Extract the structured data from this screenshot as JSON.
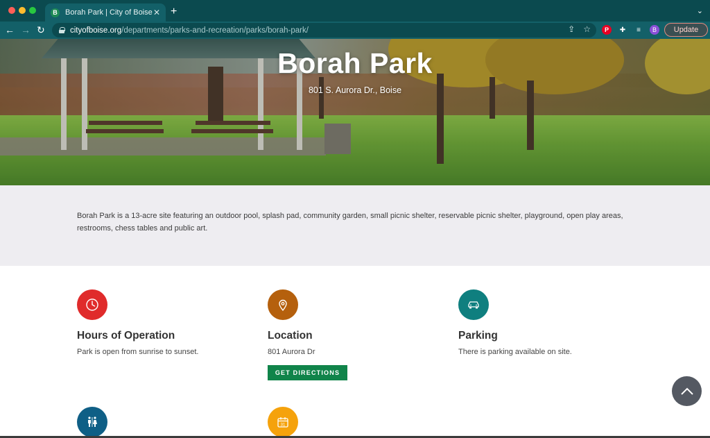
{
  "browser": {
    "tab_title": "Borah Park | City of Boise",
    "favicon_letter": "B",
    "url_host": "cityofboise.org",
    "url_path": "/departments/parks-and-recreation/parks/borah-park/",
    "profile_letter": "B",
    "update_label": "Update"
  },
  "hero": {
    "title": "Borah Park",
    "address": "801 S. Aurora Dr., Boise"
  },
  "description": "Borah Park is a 13-acre site featuring an outdoor pool, splash pad, community garden, small picnic shelter, reservable picnic shelter, playground, open play areas, restrooms, chess tables and public art.",
  "cards": {
    "hours": {
      "title": "Hours of Operation",
      "text": "Park is open from sunrise to sunset.",
      "color": "#e02b2b"
    },
    "location": {
      "title": "Location",
      "text": "801 Aurora Dr",
      "button": "GET DIRECTIONS",
      "color": "#b5600d"
    },
    "parking": {
      "title": "Parking",
      "text": "There is parking available on site.",
      "color": "#0f7f7f"
    },
    "amenities": {
      "color": "#0f5f86"
    },
    "reservations": {
      "color": "#f5a20c"
    }
  },
  "icons": {
    "hours": "clock-icon",
    "location": "map-pin-icon",
    "parking": "car-icon",
    "amenities": "restroom-icon",
    "reservations": "calendar-icon"
  }
}
